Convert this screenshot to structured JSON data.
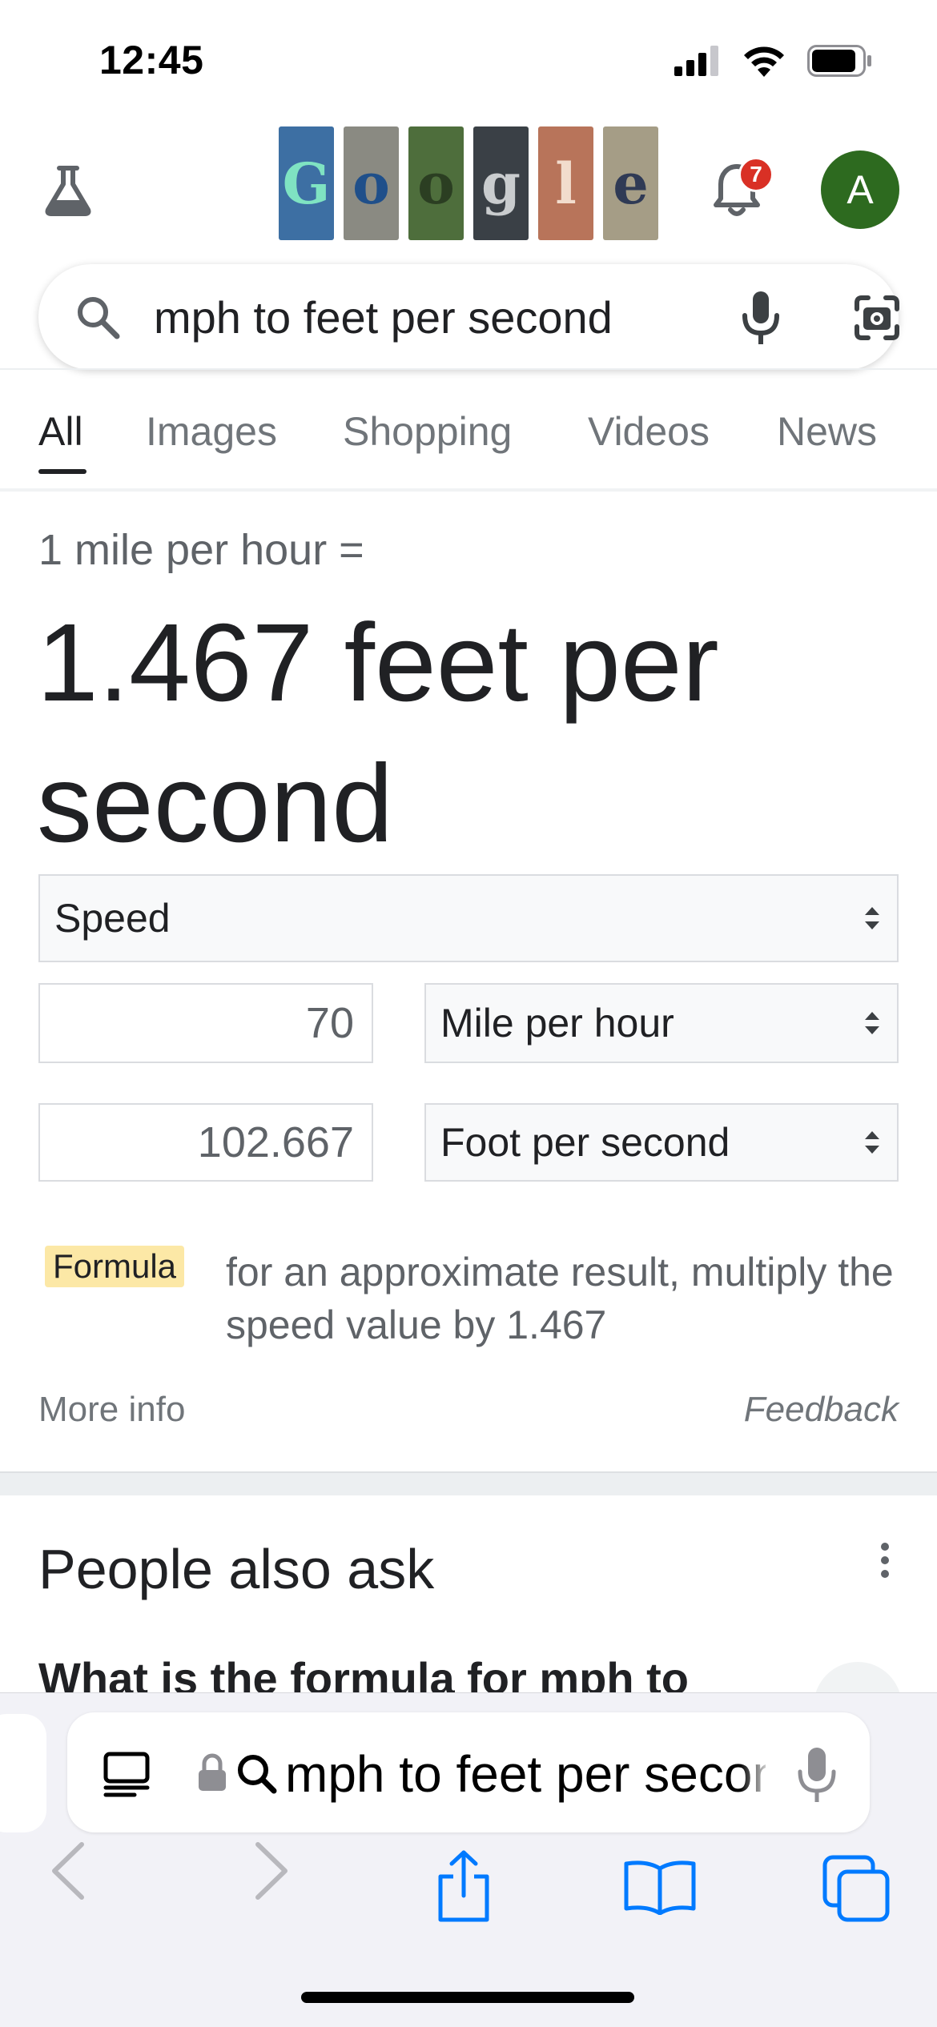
{
  "status_bar": {
    "time": "12:45"
  },
  "header": {
    "notification_count": "7",
    "avatar_initial": "A",
    "doodle_letters": [
      "G",
      "o",
      "o",
      "g",
      "l",
      "e"
    ]
  },
  "search": {
    "query": "mph to feet per second"
  },
  "tabs": [
    {
      "label": "All",
      "active": true
    },
    {
      "label": "Images",
      "active": false
    },
    {
      "label": "Shopping",
      "active": false
    },
    {
      "label": "Videos",
      "active": false
    },
    {
      "label": "News",
      "active": false
    }
  ],
  "converter": {
    "input_label": "1 mile per hour =",
    "result": "1.467 feet per second",
    "category": "Speed",
    "from_value": "70",
    "from_unit": "Mile per hour",
    "to_value": "102.667",
    "to_unit": "Foot per second",
    "formula_label": "Formula",
    "formula_text": "for an approximate result, multiply the speed value by 1.467",
    "more_info": "More info",
    "feedback": "Feedback"
  },
  "people_also_ask": {
    "title": "People also ask",
    "first_question": "What is the formula for mph to"
  },
  "safari": {
    "url_text": "mph to feet per secon"
  },
  "colors": {
    "accent_blue": "#1a73e8",
    "safari_blue": "#007aff",
    "avatar_green": "#2d6a1f",
    "badge_red": "#d93025",
    "formula_chip": "#fce8a6"
  }
}
